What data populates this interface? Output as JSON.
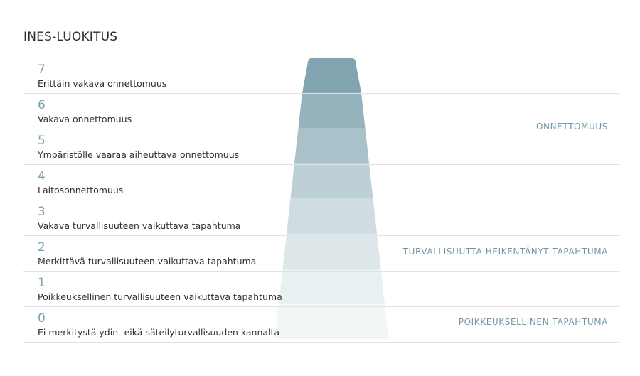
{
  "title": "INES-LUOKITUS",
  "levels": [
    {
      "number": "7",
      "label": "Erittäin vakava onnettomuus",
      "color": "#81a5b0"
    },
    {
      "number": "6",
      "label": "Vakava onnettomuus",
      "color": "#94b3bc"
    },
    {
      "number": "5",
      "label": "Ympäristölle vaaraa aiheuttava onnettomuus",
      "color": "#a9c2c9"
    },
    {
      "number": "4",
      "label": "Laitosonnettomuus",
      "color": "#bdd0d6"
    },
    {
      "number": "3",
      "label": "Vakava turvallisuuteen vaikuttava tapahtuma",
      "color": "#cfdde1"
    },
    {
      "number": "2",
      "label": "Merkittävä turvallisuuteen vaikuttava tapahtuma",
      "color": "#dde7ea"
    },
    {
      "number": "1",
      "label": "Poikkeuksellinen turvallisuuteen vaikuttava tapahtuma",
      "color": "#e9f0f2"
    },
    {
      "number": "0",
      "label": "Ei merkitystä ydin- eikä säteilyturvallisuuden kannalta",
      "color": "#f3f6f7"
    }
  ],
  "categories": {
    "accident": "ONNETTOMUUS",
    "incident": "TURVALLISUUTTA HEIKENTÄNYT TAPAHTUMA",
    "anomaly": "POIKKEUKSELLINEN TAPAHTUMA"
  }
}
